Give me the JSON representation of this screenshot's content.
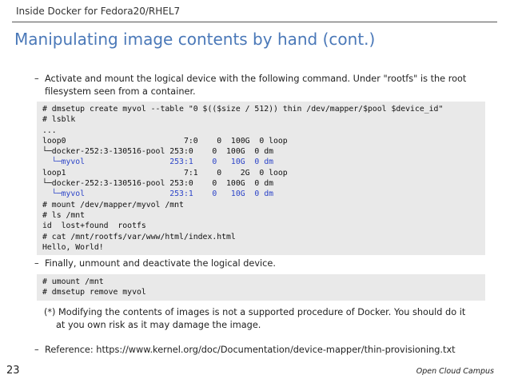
{
  "header": {
    "title": "Inside Docker for Fedora20/RHEL7"
  },
  "slide": {
    "title": "Manipulating image contents by hand (cont.)"
  },
  "bullets": [
    {
      "dash": "–",
      "line1": "Activate and mount the logical device with the following command. Under \"rootfs\" is the root",
      "line2": "filesystem seen from a container."
    },
    {
      "dash": "–",
      "line1": "Finally, unmount and deactivate the logical device."
    },
    {
      "dash": "–",
      "line1": "Reference: https://www.kernel.org/doc/Documentation/device-mapper/thin-provisioning.txt"
    }
  ],
  "code_block_1": [
    "# dmsetup create myvol --table \"0 $(($size / 512)) thin /dev/mapper/$pool $device_id\"",
    "# lsblk",
    "...",
    "loop0                         7:0    0  100G  0 loop",
    "└─docker-252:3-130516-pool 253:0    0  100G  0 dm",
    "  └─myvol                  253:1    0   10G  0 dm",
    "loop1                         7:1    0    2G  0 loop",
    "└─docker-252:3-130516-pool 253:0    0  100G  0 dm",
    "  └─myvol                  253:1    0   10G  0 dm",
    "# mount /dev/mapper/myvol /mnt",
    "# ls /mnt",
    "id  lost+found  rootfs",
    "# cat /mnt/rootfs/var/www/html/index.html",
    "Hello, World!"
  ],
  "code_block_2": [
    "# umount /mnt",
    "# dmsetup remove myvol"
  ],
  "note": {
    "line1": "(*) Modifying the contents of images is not a supported procedure of Docker. You should do it",
    "line2": "at you own risk as it may damage the image."
  },
  "footer": {
    "page_number": "23",
    "brand": "Open Cloud Campus"
  },
  "colors": {
    "title": "#4a78b8",
    "code_highlight": "#2c44c8",
    "code_background": "#e9e9e9"
  }
}
